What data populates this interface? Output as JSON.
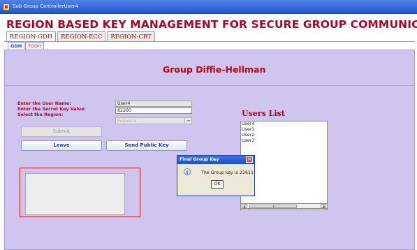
{
  "window": {
    "title": "Sub Group ControllerUser4"
  },
  "banner": {
    "text": "REGION BASED KEY MANAGEMENT FOR SECURE GROUP COMMUNICA"
  },
  "main_tabs": [
    {
      "label": "REGION-GDH",
      "active": true
    },
    {
      "label": "REGION-ECC",
      "active": false
    },
    {
      "label": "REGION-CRT",
      "active": false
    }
  ],
  "sub_tabs": [
    {
      "label": "GDH",
      "active": true
    },
    {
      "label": "TGDH",
      "active": false
    }
  ],
  "panel": {
    "heading": "Group Diffie-Hellman"
  },
  "form": {
    "username_label": "Enter the User Name:",
    "username_value": "User4",
    "secret_label": "Enter the Secret Key Value:",
    "secret_value": "82260",
    "region_label": "Select the Region:",
    "region_value": "Region A"
  },
  "buttons": {
    "submit": "Submit",
    "leave": "Leave",
    "send_public_key": "Send Public Key"
  },
  "users": {
    "heading": "Users List",
    "items": [
      "User4",
      "User1",
      "User2",
      "User3"
    ]
  },
  "dialog": {
    "title": "Final Group Key",
    "message": "The Group key is 22611",
    "ok_label": "OK",
    "close_glyph": "✕",
    "info_glyph": "i"
  },
  "colors": {
    "panel_bg": "#cfc6f0",
    "banner_red": "#b3002d",
    "heading_red": "#c8000a",
    "titlebar_blue": "#2456d4"
  },
  "icons": [
    "app-icon",
    "info-icon",
    "close-icon",
    "chevron-down-icon",
    "scroll-left-icon",
    "scroll-right-icon"
  ]
}
